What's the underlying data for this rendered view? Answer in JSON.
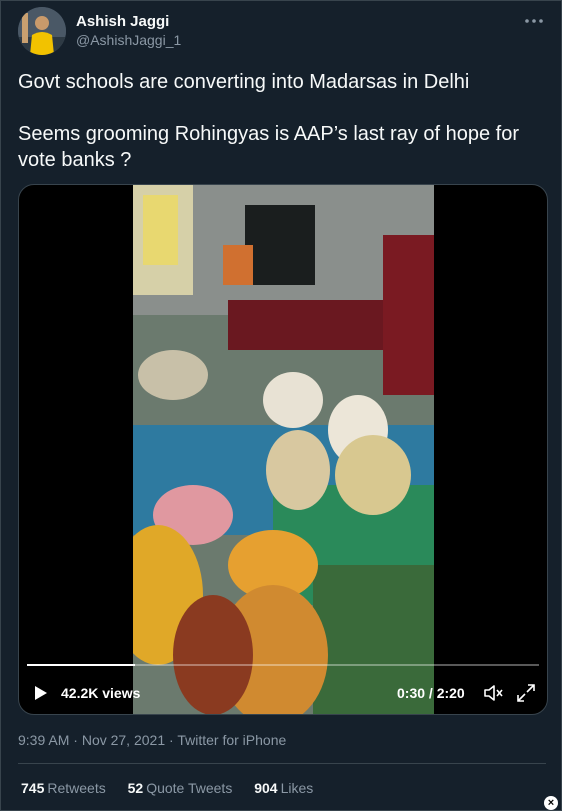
{
  "author": {
    "name": "Ashish Jaggi",
    "handle": "@AshishJaggi_1"
  },
  "more_icon": "more-horizontal-icon",
  "tweet": {
    "line1": "Govt schools are converting into Madarsas in Delhi",
    "line2": "Seems grooming Rohingyas is AAP’s last ray of hope for vote banks ?"
  },
  "video": {
    "views": "42.2K views",
    "time": "0:30 / 2:20",
    "progress": 0.21
  },
  "meta": {
    "time": "9:39 AM",
    "sep1": " · ",
    "date": "Nov 27, 2021",
    "sep2": " · ",
    "source": "Twitter for iPhone"
  },
  "stats": {
    "retweets_count": "745",
    "retweets_label": "Retweets",
    "quotes_count": "52",
    "quotes_label": "Quote Tweets",
    "likes_count": "904",
    "likes_label": "Likes"
  },
  "colors": {
    "background": "#15202b",
    "text": "#f7f9f9",
    "secondary": "#8b98a5",
    "border": "#38444d"
  }
}
